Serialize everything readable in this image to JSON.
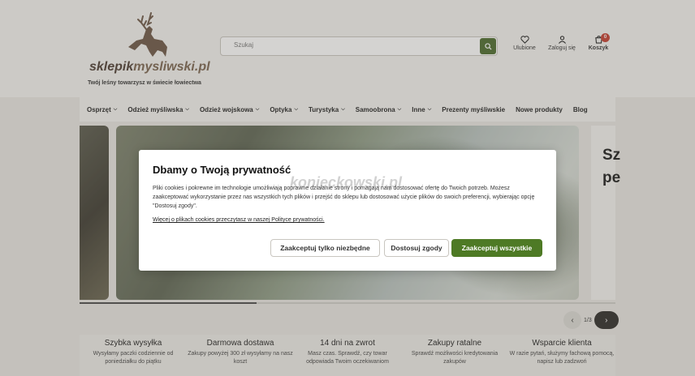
{
  "header": {
    "logo_text_main": "sklepik",
    "logo_text_accent": "mysliwski.pl",
    "tagline": "Twój leśny towarzysz w świecie łowiectwa",
    "search": {
      "placeholder": "Szukaj"
    },
    "icons": [
      {
        "name": "heart-icon",
        "label": "Ulubione"
      },
      {
        "name": "user-icon",
        "label": "Zaloguj się"
      },
      {
        "name": "cart-icon",
        "label": "Koszyk",
        "badge": "0"
      }
    ]
  },
  "nav": {
    "items": [
      {
        "label": "Osprzęt",
        "dropdown": true
      },
      {
        "label": "Odzież myśliwska",
        "dropdown": true
      },
      {
        "label": "Odzież wojskowa",
        "dropdown": true
      },
      {
        "label": "Optyka",
        "dropdown": true
      },
      {
        "label": "Turystyka",
        "dropdown": true
      },
      {
        "label": "Samoobrona",
        "dropdown": true
      },
      {
        "label": "Inne",
        "dropdown": true
      },
      {
        "label": "Prezenty myśliwskie",
        "dropdown": false
      },
      {
        "label": "Nowe produkty",
        "dropdown": false
      },
      {
        "label": "Blog",
        "dropdown": false
      }
    ]
  },
  "slider": {
    "right_text_line1": "Sz",
    "right_text_line2": "pe",
    "counter": "1/3",
    "progress": 0.33
  },
  "features": [
    {
      "title": "Szybka wysyłka",
      "desc": "Wysyłamy paczki codziennie od poniedziałku do piątku"
    },
    {
      "title": "Darmowa dostawa",
      "desc": "Zakupy powyżej 300 zł wysyłamy na nasz koszt"
    },
    {
      "title": "14 dni na zwrot",
      "desc": "Masz czas. Sprawdź, czy towar odpowiada Twoim oczekiwaniom"
    },
    {
      "title": "Zakupy ratalne",
      "desc": "Sprawdź możliwości kredytowania zakupów"
    },
    {
      "title": "Wsparcie klienta",
      "desc": "W razie pytań, służymy fachową pomocą, napisz lub zadzwoń"
    }
  ],
  "cookie_modal": {
    "title": "Dbamy o Twoją prywatność",
    "body": "Pliki cookies i pokrewne im technologie umożliwiają poprawne działanie strony i pomagają nam dostosować ofertę do Twoich potrzeb. Możesz zaakceptować wykorzystanie przez nas wszystkich tych plików i przejść do sklepu lub dostosować użycie plików do swoich preferencji, wybierając opcję \"Dostosuj zgody\".",
    "link": "Więcej o plikach cookies przeczytasz w naszej Polityce prywatności.",
    "watermark": "konieckowski.pl",
    "buttons": {
      "necessary": "Zaakceptuj tylko niezbędne",
      "customize": "Dostosuj zgody",
      "accept_all": "Zaakceptuj wszystkie"
    }
  },
  "colors": {
    "accent_green": "#4e7a25",
    "search_button": "#4a6a2b",
    "cart_badge": "#c43c2e",
    "logo_brown": "#4b3b31"
  }
}
